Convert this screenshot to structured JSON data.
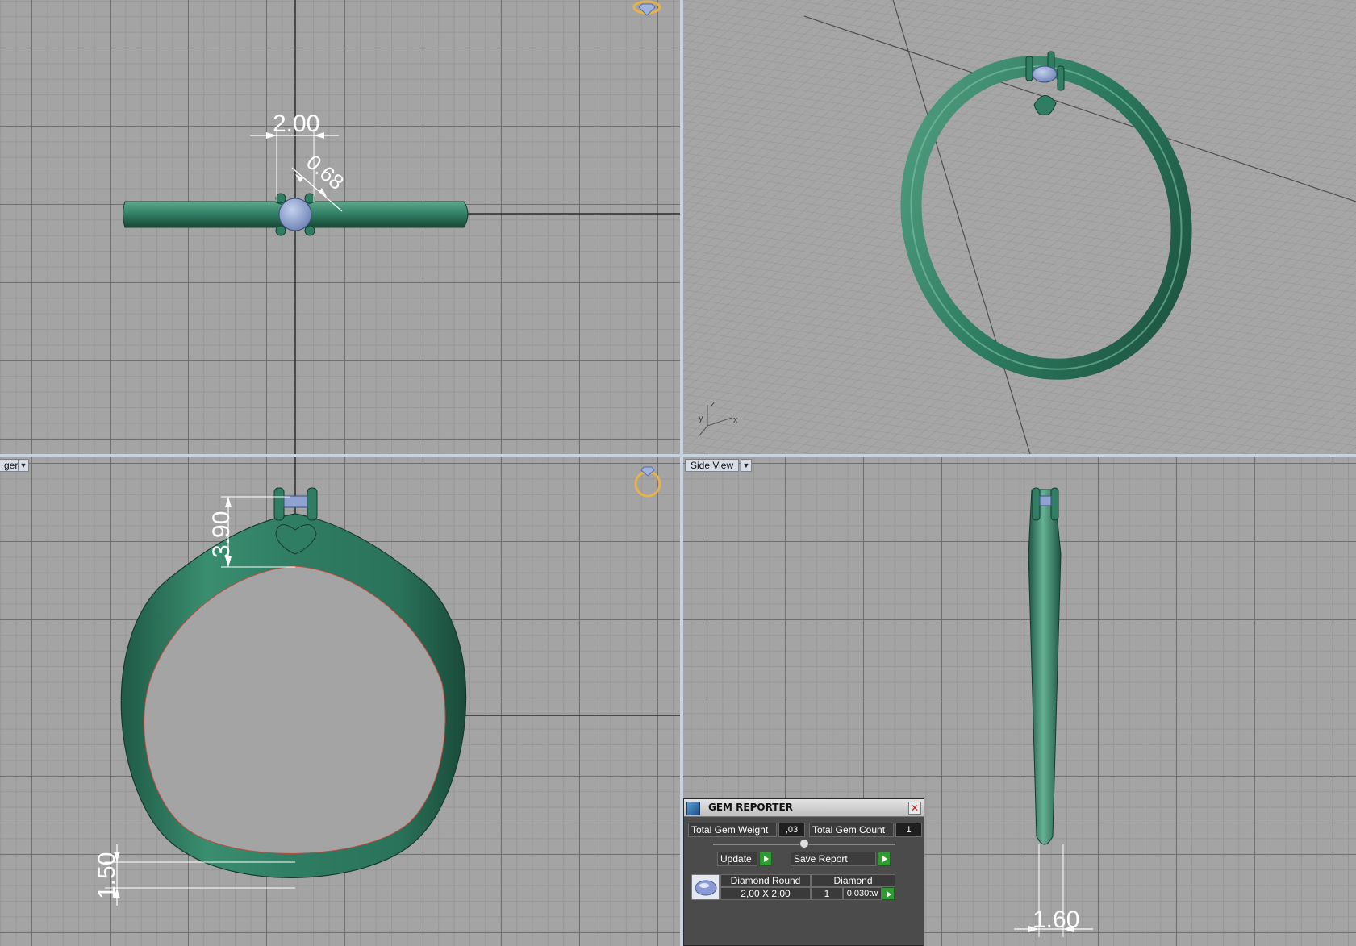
{
  "viewports": {
    "front_label": "ger",
    "side_label": "Side View",
    "perspective_axes": {
      "x": "x",
      "y": "y",
      "z": "z"
    }
  },
  "dimensions": {
    "top_width": "2.00",
    "top_diag": "0.68",
    "front_height": "3.90",
    "front_thickness": "1.50",
    "side_width": "1.60"
  },
  "gem_reporter": {
    "title": "GEM REPORTER",
    "total_weight_label": "Total Gem Weight",
    "total_weight_value": ",03",
    "total_count_label": "Total Gem Count",
    "total_count_value": "1",
    "update_label": "Update",
    "save_report_label": "Save Report",
    "gem_name": "Diamond Round",
    "gem_material": "Diamond",
    "gem_size": "2,00 X 2,00",
    "gem_qty": "1",
    "gem_weight": "0,030tw"
  },
  "colors": {
    "metal": "#2f7d63",
    "gem": "#8ea3cf",
    "viewport_bg": "#a4a4a4",
    "separator": "#c8d3e2"
  }
}
